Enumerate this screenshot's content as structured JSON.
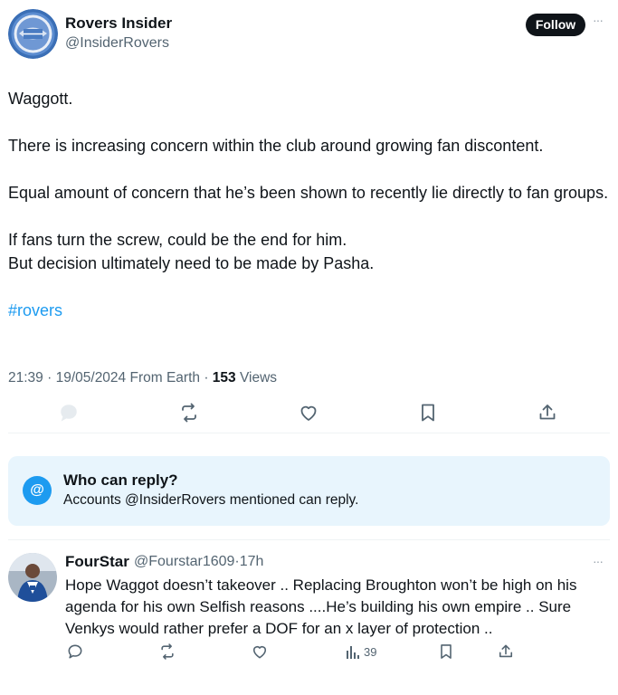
{
  "tweet": {
    "author_name": "Rovers Insider",
    "author_handle": "@InsiderRovers",
    "follow_label": "Follow",
    "more_label": "···",
    "paragraphs": [
      "Waggott.",
      "There is increasing concern within the club around growing fan discontent.",
      "Equal amount of concern that he’s been shown to recently lie directly to fan groups.",
      "If fans turn the screw, could be the end for him.",
      "But decision ultimately need to be made by Pasha."
    ],
    "hashtag": "#rovers",
    "time": "21:39",
    "date": "19/05/2024",
    "source": "From Earth",
    "views_count": "153",
    "views_label": "Views",
    "sep": "·"
  },
  "who_can_reply": {
    "icon": "@",
    "title": "Who can reply?",
    "description": "Accounts @InsiderRovers mentioned can reply."
  },
  "reply": {
    "author_name": "FourStar",
    "author_handle": "@Fourstar1609",
    "sep": "·",
    "time": "17h",
    "more_label": "···",
    "text": "Hope Waggot doesn’t takeover  .. Replacing Broughton  won’t be high on his agenda for his own Selfish reasons ....He’s building his own empire .. Sure Venkys would rather prefer a DOF for an x layer of protection ..",
    "views_count": "39"
  },
  "icons": {
    "action_color": "#536471",
    "reply_icon_faded": "#c9d2d9",
    "accent": "#1d9bf0"
  }
}
